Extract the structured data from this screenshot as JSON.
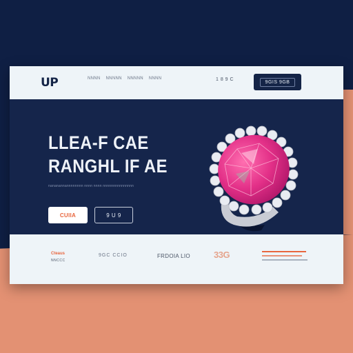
{
  "header": {
    "logo": "UP",
    "nav": [
      "NNNN",
      "NNNNN",
      "NNNNN",
      "NNNN"
    ],
    "right_text": "1 8 9 C",
    "cta": "9GIS 9GB"
  },
  "hero": {
    "title_line1": "LLEA-F CAE",
    "title_line2": "RANGHL IF AE",
    "subtitle": "nananannannnnnnnn  nnnn nnnn nnnnnnnnnnnnnnn",
    "primary_button": "CUIIA",
    "secondary_button": "9 U 9",
    "gem_colors": {
      "gem_dark": "#b01669",
      "gem_mid": "#e33088",
      "gem_light": "#ff6fb0",
      "band": "#c9ccd4"
    }
  },
  "features": {
    "f1_line1": "Cteaus",
    "f1_line2": "NNCCC",
    "f2": "9GC CCIO",
    "f3": "FRDOIA LIO",
    "f4": "33G"
  },
  "colors": {
    "navy": "#15254b",
    "light": "#eef4f8",
    "accent": "#e8663e",
    "salmon": "#e39173"
  }
}
